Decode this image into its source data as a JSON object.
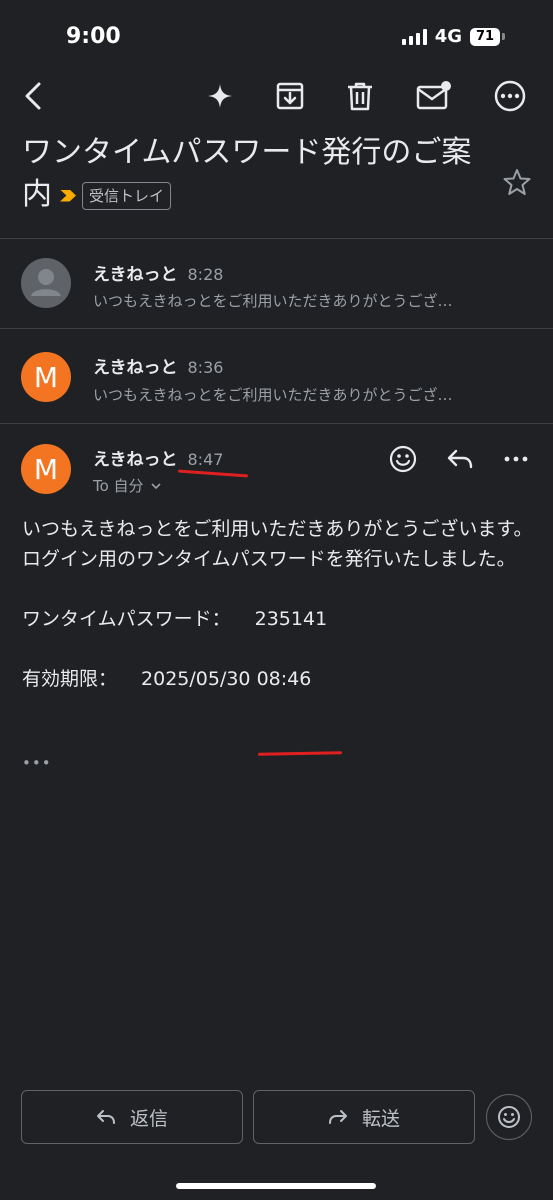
{
  "status": {
    "time": "9:00",
    "network": "4G",
    "battery": "71"
  },
  "subject": "ワンタイムパスワード発行のご案内",
  "label": "受信トレイ",
  "threads": [
    {
      "initial": "",
      "sender": "えきねっと",
      "time": "8:28",
      "snippet": "いつもえきねっとをご利用いただきありがとうござ…"
    },
    {
      "initial": "M",
      "sender": "えきねっと",
      "time": "8:36",
      "snippet": "いつもえきねっとをご利用いただきありがとうござ…"
    }
  ],
  "open_message": {
    "initial": "M",
    "sender": "えきねっと",
    "time": "8:47",
    "to": "To 自分",
    "body": {
      "line1": "いつもえきねっとをご利用いただきありがとうございます。",
      "line2": "ログイン用のワンタイムパスワードを発行いたしました。",
      "otp_label": "ワンタイムパスワード：",
      "otp_value": "235141",
      "expiry_label": "有効期限：",
      "expiry_value": "2025/05/30 08:46"
    },
    "more": "•••"
  },
  "actions": {
    "reply": "返信",
    "forward": "転送"
  },
  "colors": {
    "background": "#202124",
    "avatar_orange": "#f47521",
    "avatar_gray": "#5f6368",
    "label_arrow": "#f9ab00",
    "annotation": "#e02020"
  }
}
